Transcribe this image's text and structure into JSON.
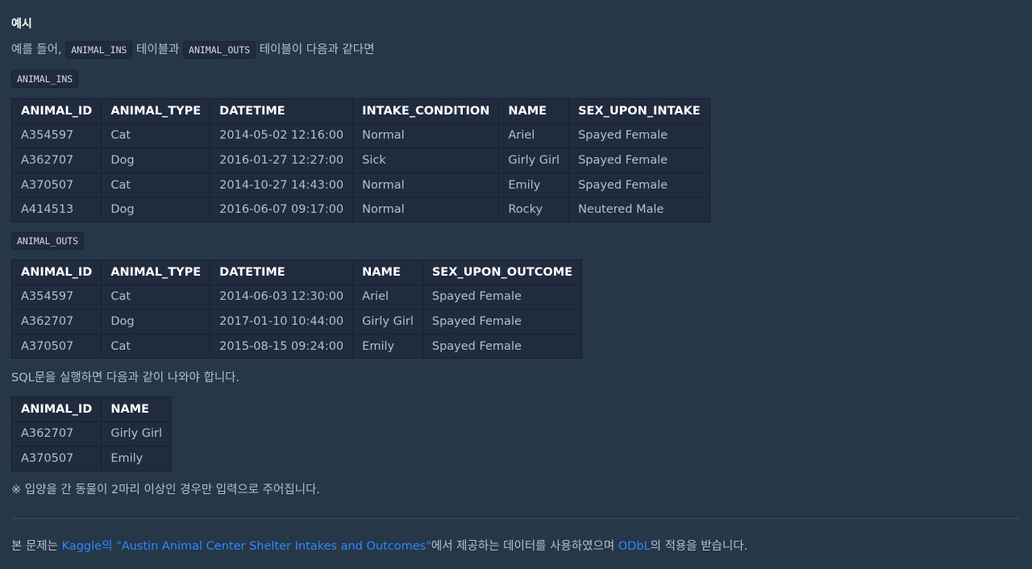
{
  "heading": "예시",
  "intro": {
    "prefix": "예를 들어, ",
    "code1": "ANIMAL_INS",
    "mid": " 테이블과 ",
    "code2": "ANIMAL_OUTS",
    "suffix": " 테이블이 다음과 같다면"
  },
  "table_ins": {
    "label": "ANIMAL_INS",
    "headers": [
      "ANIMAL_ID",
      "ANIMAL_TYPE",
      "DATETIME",
      "INTAKE_CONDITION",
      "NAME",
      "SEX_UPON_INTAKE"
    ],
    "rows": [
      [
        "A354597",
        "Cat",
        "2014-05-02 12:16:00",
        "Normal",
        "Ariel",
        "Spayed Female"
      ],
      [
        "A362707",
        "Dog",
        "2016-01-27 12:27:00",
        "Sick",
        "Girly Girl",
        "Spayed Female"
      ],
      [
        "A370507",
        "Cat",
        "2014-10-27 14:43:00",
        "Normal",
        "Emily",
        "Spayed Female"
      ],
      [
        "A414513",
        "Dog",
        "2016-06-07 09:17:00",
        "Normal",
        "Rocky",
        "Neutered Male"
      ]
    ]
  },
  "table_outs": {
    "label": "ANIMAL_OUTS",
    "headers": [
      "ANIMAL_ID",
      "ANIMAL_TYPE",
      "DATETIME",
      "NAME",
      "SEX_UPON_OUTCOME"
    ],
    "rows": [
      [
        "A354597",
        "Cat",
        "2014-06-03 12:30:00",
        "Ariel",
        "Spayed Female"
      ],
      [
        "A362707",
        "Dog",
        "2017-01-10 10:44:00",
        "Girly Girl",
        "Spayed Female"
      ],
      [
        "A370507",
        "Cat",
        "2015-08-15 09:24:00",
        "Emily",
        "Spayed Female"
      ]
    ]
  },
  "result_text": "SQL문을 실행하면 다음과 같이 나와야 합니다.",
  "table_result": {
    "headers": [
      "ANIMAL_ID",
      "NAME"
    ],
    "rows": [
      [
        "A362707",
        "Girly Girl"
      ],
      [
        "A370507",
        "Emily"
      ]
    ]
  },
  "note": "※ 입양을 간 동물이 2마리 이상인 경우만 입력으로 주어집니다.",
  "footer": {
    "prefix": "본 문제는 ",
    "link1": "Kaggle의 \"Austin Animal Center Shelter Intakes and Outcomes\"",
    "mid": "에서 제공하는 데이터를 사용하였으며 ",
    "link2": "ODbL",
    "suffix": "의 적용을 받습니다."
  },
  "colors": {
    "background": "#263747",
    "table_bg": "#202b3d",
    "link": "#2d88ff"
  }
}
